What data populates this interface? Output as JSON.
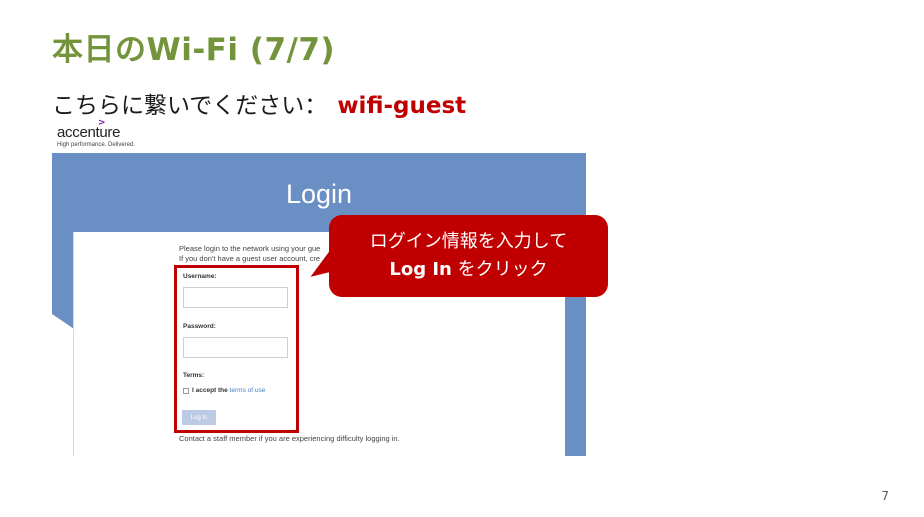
{
  "slide": {
    "title": "本日のWi-Fi (7/7)",
    "instruction_prefix": "こちらに繋いでください：",
    "ssid": "wifi-guest",
    "page_number": "7"
  },
  "logo": {
    "mark": ">",
    "wordmark": "accenture",
    "tagline": "High performance. Delivered."
  },
  "login_page": {
    "title": "Login",
    "intro_line1": "Please login to the network using your gue",
    "intro_line2": "If you don't have a guest user account, cre",
    "username_label": "Username:",
    "username_value": "",
    "password_label": "Password:",
    "password_value": "",
    "terms_label": "Terms:",
    "accept_text": "I accept the",
    "terms_link": "terms of use",
    "login_button": "Log In",
    "contact_text": "Contact a staff member if you are experiencing difficulty logging in."
  },
  "callout": {
    "line1": "ログイン情報を入力して",
    "line2_bold": "Log In",
    "line2_rest": " をクリック"
  },
  "colors": {
    "title_green": "#74943c",
    "accent_red": "#c00000",
    "login_blue": "#6a8fc4"
  }
}
